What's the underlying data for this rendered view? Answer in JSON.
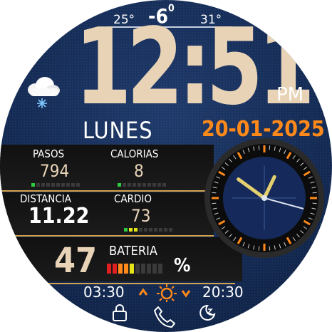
{
  "weather": {
    "low": "25°",
    "current": "-6",
    "current_unit": "0",
    "high": "31°",
    "icon": "snow-cloud-icon"
  },
  "time": {
    "value": "12:51",
    "ampm": "PM"
  },
  "day": "LUNES",
  "date": "20-01-2025",
  "stats": {
    "steps": {
      "label": "PASOS",
      "value": "794",
      "level": 1
    },
    "calories": {
      "label": "CALORIAS",
      "value": "8",
      "level": 1
    },
    "distance": {
      "label": "DISTANCIA",
      "value": "11.22",
      "level": 9
    },
    "cardio": {
      "label": "CARDIO",
      "value": "73",
      "level": 3
    },
    "battery": {
      "label": "BATERIA",
      "value": "47",
      "unit": "%",
      "level": 5
    }
  },
  "sun": {
    "sunrise": "03:30",
    "sunset": "20:30"
  },
  "analog": {
    "hours": 12,
    "minutes": 51
  },
  "colors": {
    "accent": "#ff8a1a",
    "digits": "#e8d3b7",
    "gold": "#d4a24c",
    "green": "#2ecc40",
    "yellow": "#e5e51a",
    "red": "#e02020"
  }
}
